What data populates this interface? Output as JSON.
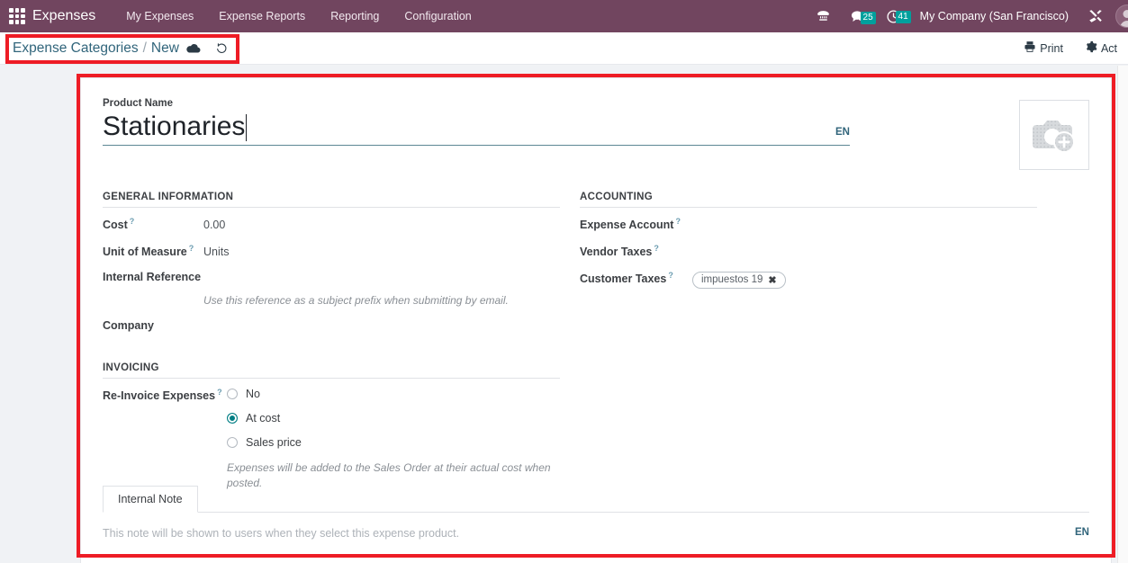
{
  "navbar": {
    "apps_icon": "apps-grid-icon",
    "brand": "Expenses",
    "menu": [
      {
        "label": "My Expenses"
      },
      {
        "label": "Expense Reports"
      },
      {
        "label": "Reporting"
      },
      {
        "label": "Configuration"
      }
    ],
    "icons": [
      {
        "name": "activities-icon",
        "glyph": "☎",
        "badge": null
      },
      {
        "name": "messages-icon",
        "glyph": "ὊC",
        "badge": "25"
      },
      {
        "name": "activity-clock-icon",
        "glyph": "⏱",
        "badge": "41"
      }
    ],
    "company": "My Company (San Francisco)",
    "tools_icon": "tools-icon",
    "avatar": "user-avatar"
  },
  "controlpanel": {
    "breadcrumb_root": "Expense Categories",
    "breadcrumb_sep": "/",
    "breadcrumb_current": "New",
    "save_icon": "cloud-save-icon",
    "discard_icon": "discard-undo-icon",
    "print_label": "Print",
    "print_icon": "printer-icon",
    "action_label": "Act",
    "action_icon": "gear-icon"
  },
  "form": {
    "product_name_label": "Product Name",
    "product_name_value": "Stationaries",
    "title_lang": "EN",
    "image_placeholder_icon": "camera-add-icon",
    "general": {
      "title": "GENERAL INFORMATION",
      "fields": [
        {
          "label": "Cost",
          "help": "?",
          "value": "0.00"
        },
        {
          "label": "Unit of Measure",
          "help": "?",
          "value": "Units"
        },
        {
          "label": "Internal Reference",
          "help": "",
          "value": ""
        },
        {
          "label": "Company",
          "help": "",
          "value": ""
        }
      ],
      "internal_reference_hint": "Use this reference as a subject prefix when submitting by email."
    },
    "accounting": {
      "title": "ACCOUNTING",
      "fields": [
        {
          "label": "Expense Account",
          "help": "?",
          "value": ""
        },
        {
          "label": "Vendor Taxes",
          "help": "?",
          "value": ""
        },
        {
          "label": "Customer Taxes",
          "help": "?",
          "value": ""
        }
      ],
      "customer_tax_tag": "impuestos 19",
      "tag_remove": "✖"
    },
    "invoicing": {
      "title": "INVOICING",
      "field_label": "Re-Invoice Expenses",
      "help": "?",
      "options": [
        {
          "label": "No",
          "selected": false
        },
        {
          "label": "At cost",
          "selected": true
        },
        {
          "label": "Sales price",
          "selected": false
        }
      ],
      "note": "Expenses will be added to the Sales Order at their actual cost when posted."
    },
    "notebook": {
      "tabs": [
        {
          "label": "Internal Note",
          "active": true
        }
      ],
      "placeholder": "This note will be shown to users when they select this expense product.",
      "lang": "EN"
    }
  },
  "colors": {
    "navbar_purple": "#71455f",
    "badge_teal": "#00A09D",
    "link_blue": "#31657b",
    "radio_teal": "#017e84",
    "annotation_red": "#ee1c25",
    "page_bg": "#f0f2f5"
  }
}
